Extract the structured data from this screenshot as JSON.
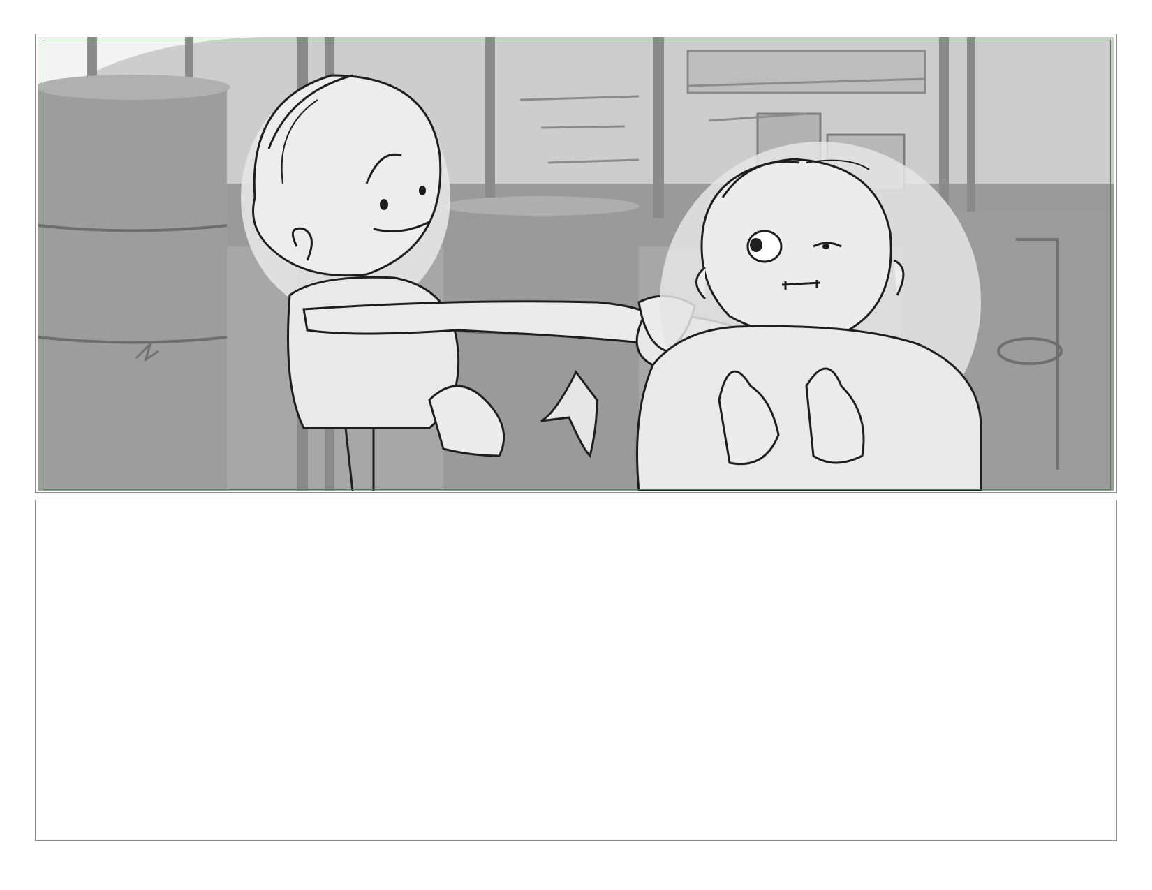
{
  "page": {
    "kind": "storyboard-page"
  },
  "panel": {
    "frame_color": "#8c8c8c",
    "safe_area_color": "#3f8a3f",
    "sketch_palette": {
      "background_tone": "#b5b5b5",
      "midground_tone": "#8e8e8e",
      "character_fill": "#ececec",
      "line_color": "#1e1e1e"
    }
  },
  "notes": {
    "text": ""
  }
}
